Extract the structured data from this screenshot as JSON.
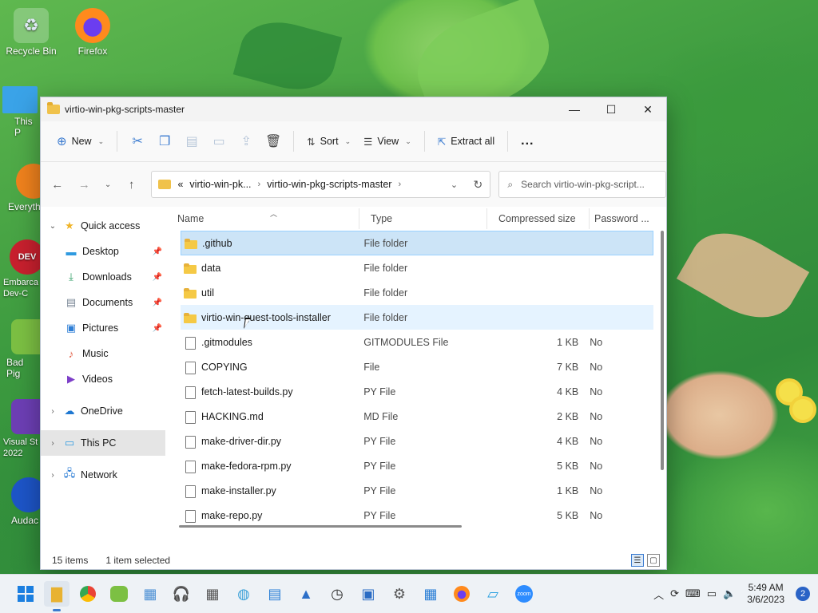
{
  "desktop": {
    "icons": [
      {
        "label": "Recycle Bin",
        "icon": "recycle-bin-icon"
      },
      {
        "label": "Firefox",
        "icon": "firefox-icon"
      },
      {
        "label": "This P",
        "icon": "this-pc-icon"
      },
      {
        "label": "Everyth",
        "icon": "everything-icon"
      },
      {
        "label": "Embarca Dev-C",
        "icon": "devcpp-icon"
      },
      {
        "label": "Bad Pig",
        "icon": "bad-piggies-icon"
      },
      {
        "label": "Visual St 2022",
        "icon": "visual-studio-icon"
      },
      {
        "label": "Audac",
        "icon": "audacity-icon"
      }
    ]
  },
  "window": {
    "title": "virtio-win-pkg-scripts-master",
    "toolbar": {
      "new_label": "New",
      "sort_label": "Sort",
      "view_label": "View",
      "extract_label": "Extract all",
      "more_label": "..."
    },
    "address": {
      "prefix": "«",
      "segments": [
        "virtio-win-pk...",
        "virtio-win-pkg-scripts-master"
      ],
      "search_placeholder": "Search virtio-win-pkg-script..."
    },
    "nav": {
      "quick_access": "Quick access",
      "items": [
        {
          "label": "Desktop",
          "icon": "desktop-icon"
        },
        {
          "label": "Downloads",
          "icon": "downloads-icon"
        },
        {
          "label": "Documents",
          "icon": "documents-icon"
        },
        {
          "label": "Pictures",
          "icon": "pictures-icon"
        },
        {
          "label": "Music",
          "icon": "music-icon"
        },
        {
          "label": "Videos",
          "icon": "videos-icon"
        }
      ],
      "onedrive": "OneDrive",
      "this_pc": "This PC",
      "network": "Network"
    },
    "columns": {
      "name": "Name",
      "type": "Type",
      "compressed_size": "Compressed size",
      "password": "Password ..."
    },
    "files": [
      {
        "name": ".github",
        "type": "File folder",
        "size": "",
        "password": "",
        "kind": "folder"
      },
      {
        "name": "data",
        "type": "File folder",
        "size": "",
        "password": "",
        "kind": "folder"
      },
      {
        "name": "util",
        "type": "File folder",
        "size": "",
        "password": "",
        "kind": "folder"
      },
      {
        "name": "virtio-win-guest-tools-installer",
        "type": "File folder",
        "size": "",
        "password": "",
        "kind": "folder"
      },
      {
        "name": ".gitmodules",
        "type": "GITMODULES File",
        "size": "1 KB",
        "password": "No",
        "kind": "doc"
      },
      {
        "name": "COPYING",
        "type": "File",
        "size": "7 KB",
        "password": "No",
        "kind": "doc"
      },
      {
        "name": "fetch-latest-builds.py",
        "type": "PY File",
        "size": "4 KB",
        "password": "No",
        "kind": "doc"
      },
      {
        "name": "HACKING.md",
        "type": "MD File",
        "size": "2 KB",
        "password": "No",
        "kind": "doc"
      },
      {
        "name": "make-driver-dir.py",
        "type": "PY File",
        "size": "4 KB",
        "password": "No",
        "kind": "doc"
      },
      {
        "name": "make-fedora-rpm.py",
        "type": "PY File",
        "size": "5 KB",
        "password": "No",
        "kind": "doc"
      },
      {
        "name": "make-installer.py",
        "type": "PY File",
        "size": "1 KB",
        "password": "No",
        "kind": "doc"
      },
      {
        "name": "make-repo.py",
        "type": "PY File",
        "size": "5 KB",
        "password": "No",
        "kind": "doc"
      }
    ],
    "status": {
      "item_count": "15 items",
      "selection": "1 item selected"
    }
  },
  "taskbar": {
    "time": "5:49 AM",
    "date": "3/6/2023",
    "notifications": "2",
    "zoom_label": "zoom"
  },
  "colors": {
    "selection_bg": "#cce4f7",
    "hover_bg": "#e5f3ff",
    "accent": "#3b7bd0"
  }
}
